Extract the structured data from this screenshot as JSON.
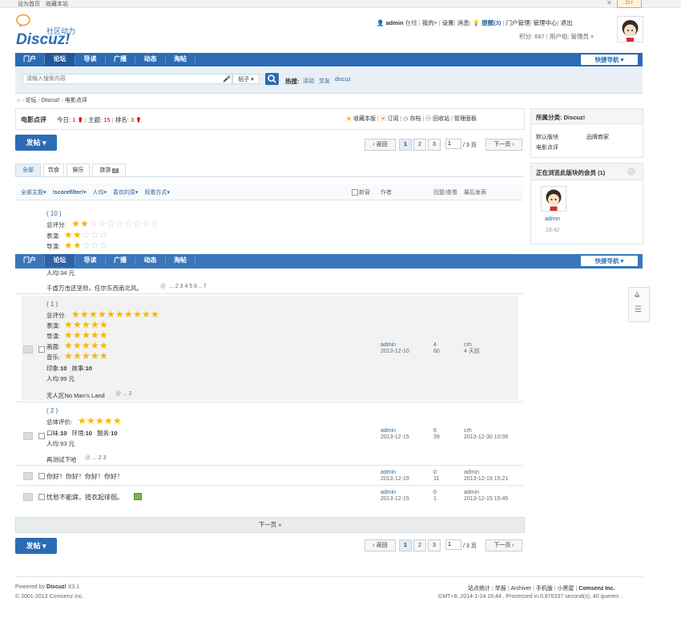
{
  "topbar": {
    "set_home": "设为首页",
    "favorite": "收藏本站",
    "diy": "DIY"
  },
  "logo": {
    "tagline": "社区动力",
    "brand": "Discuz!"
  },
  "user": {
    "name": "admin",
    "status": "在线",
    "mine": "我的",
    "settings": "设置",
    "messages": "消息",
    "reminder": "提醒(3)",
    "portal_manage": "门户管理",
    "admin_center": "管理中心",
    "logout": "退出",
    "points": "积分: 667",
    "usergroup": "用户组: 管理员"
  },
  "nav": {
    "items": [
      "门户",
      "论坛",
      "导读",
      "广播",
      "动态",
      "淘帖"
    ],
    "active": 1,
    "quick_nav": "快捷导航"
  },
  "search": {
    "placeholder": "请输入搜索内容",
    "scope": "帖子",
    "hot_label": "热搜:",
    "hot": [
      "活动",
      "交友",
      "discuz"
    ]
  },
  "breadcrumb": [
    "论坛",
    "Discuz!",
    "电影点评"
  ],
  "forum": {
    "name": "电影点评",
    "today_label": "今日:",
    "today": "1",
    "topics_label": "主题:",
    "topics": "15",
    "rank_label": "排名:",
    "rank": "3",
    "actions": [
      "收藏本版",
      "订阅",
      "存档",
      "回收站",
      "管理面板"
    ]
  },
  "new_post": "发帖",
  "pager": {
    "back": "返回",
    "pages": [
      "1",
      "2",
      "3"
    ],
    "current": "1",
    "total": "/ 3 页",
    "next": "下一页"
  },
  "type_tabs": {
    "items": [
      "全部",
      "饮食",
      "娱乐",
      "旅游"
    ],
    "badge": "2"
  },
  "filters": {
    "items": [
      "全部主题",
      "!scorefilter!",
      "人均",
      "喜欢的菜",
      "观看方式"
    ],
    "new_window": "新窗",
    "author": "作者",
    "replies_views": "回复/查看",
    "last_post": "最后发表"
  },
  "threads": [
    {
      "count": "( 10 )",
      "overall_label": "总评分:",
      "overall": 2,
      "overall_max": 10,
      "ratings": [
        {
          "label": "表演:",
          "stars": 2
        },
        {
          "label": "导演:",
          "stars": 2
        }
      ],
      "per_person": "人均:34 元",
      "title": "千虚万击还坚劲，任尔东西南北风。",
      "pages": "... 2 3 4 5 6 .. 7"
    },
    {
      "count": "( 1 )",
      "overall_label": "总评分:",
      "overall": 10,
      "overall_max": 10,
      "ratings": [
        {
          "label": "表演:",
          "stars": 5
        },
        {
          "label": "导演:",
          "stars": 5
        },
        {
          "label": "画面:",
          "stars": 5
        },
        {
          "label": "音乐:",
          "stars": 5
        }
      ],
      "impression_label": "印象:",
      "impression": "10",
      "story_label": "故事:",
      "story": "10",
      "per_person": "人均:99 元",
      "title": "无人区No Man's Land",
      "pages": "... 2",
      "author": "admin",
      "author_date": "2013-12-10",
      "replies": "4",
      "views": "60",
      "last_author": "crh",
      "last_time": "4 天前"
    },
    {
      "count": "( 2 )",
      "overall_label": "总体评价:",
      "overall": 5,
      "overall_max": 5,
      "taste_label": "口味:",
      "taste": "10",
      "env_label": "环境:",
      "env": "10",
      "service_label": "服务:",
      "service": "10",
      "per_person": "人均:93 元",
      "title": "再测试下哈",
      "pages": "... 2 3",
      "author": "admin",
      "author_date": "2013-12-15",
      "replies": "6",
      "views": "39",
      "last_author": "crh",
      "last_time": "2013-12-30 10:06"
    },
    {
      "title": "你好！你好！你好！你好！",
      "author": "admin",
      "author_date": "2013-12-19",
      "replies": "0",
      "views": "11",
      "last_author": "admin",
      "last_time": "2013-12-19 15:21"
    },
    {
      "title": "忧愁不能寐，揽衣起徘徊。",
      "author": "admin",
      "author_date": "2013-12-15",
      "replies": "0",
      "views": "1",
      "last_author": "admin",
      "last_time": "2013-12-15 15:45"
    }
  ],
  "next_page": "下一页 »",
  "sidebar": {
    "subforum_title": "所属分类: Discuz!",
    "links": [
      "默认版块",
      "品牌商家",
      "电影点评"
    ],
    "online_title": "正在浏览此版块的会员 (1)",
    "member": "admin",
    "member_time": "16:42"
  },
  "footer": {
    "powered_prefix": "Powered by ",
    "powered_brand": "Discuz!",
    "version": "X3.1",
    "copyright": "© 2001-2013 Comsenz Inc.",
    "links": [
      "站点统计",
      "举报",
      "Archiver",
      "手机版",
      "小黑屋"
    ],
    "company": "Comsenz Inc.",
    "gmt": "GMT+8, 2014-1-24 16:44 , Processed in 0.876337 second(s), 40 queries ."
  },
  "colors": {
    "nav": "#2b6cb5",
    "accent_red": "#d00000",
    "star": "#f5b800"
  }
}
